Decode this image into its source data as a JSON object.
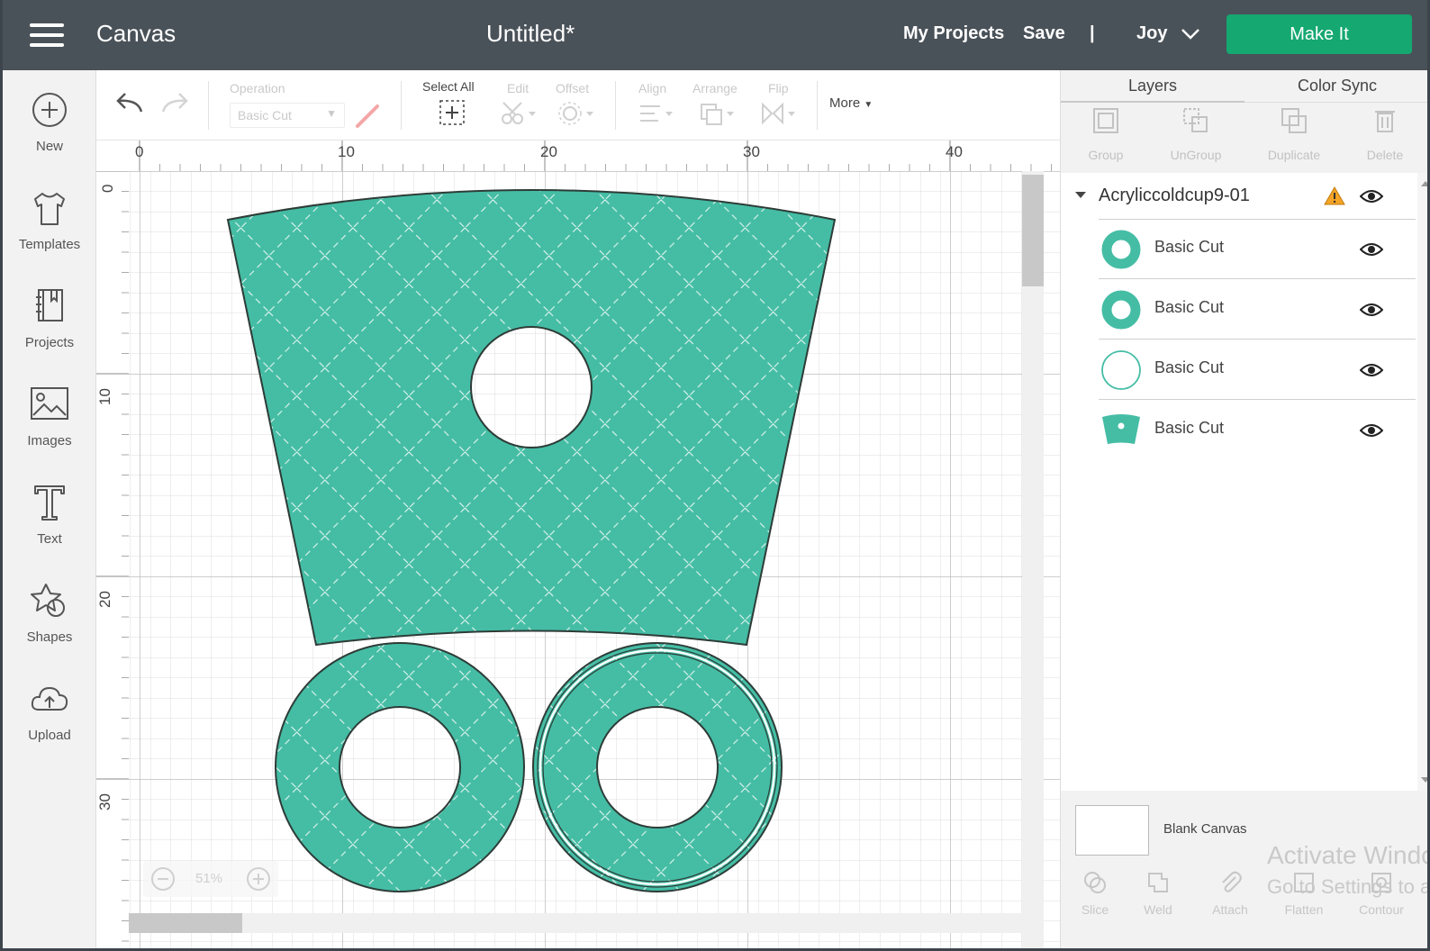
{
  "topbar": {
    "app_title": "Canvas",
    "document_title": "Untitled*",
    "my_projects": "My Projects",
    "save": "Save",
    "separator": "|",
    "user": "Joy",
    "make_it": "Make It"
  },
  "sidebar": {
    "items": [
      {
        "label": "New",
        "icon": "plus-circle-icon"
      },
      {
        "label": "Templates",
        "icon": "tshirt-icon"
      },
      {
        "label": "Projects",
        "icon": "book-icon"
      },
      {
        "label": "Images",
        "icon": "image-icon"
      },
      {
        "label": "Text",
        "icon": "text-t-icon"
      },
      {
        "label": "Shapes",
        "icon": "shapes-icon"
      },
      {
        "label": "Upload",
        "icon": "cloud-upload-icon"
      }
    ]
  },
  "toolbar": {
    "operation_label": "Operation",
    "operation_value": "Basic Cut",
    "select_all": "Select All",
    "edit": "Edit",
    "offset": "Offset",
    "align": "Align",
    "arrange": "Arrange",
    "flip": "Flip",
    "more": "More"
  },
  "rulers": {
    "top": [
      "0",
      "10",
      "20",
      "30",
      "40"
    ],
    "left": [
      "0",
      "10",
      "20",
      "30"
    ]
  },
  "zoom": {
    "label": "51%"
  },
  "colors": {
    "topbar": "#4a5259",
    "accent": "#15a871",
    "shape_fill": "#45bda5",
    "warning": "#f3a325"
  },
  "panel": {
    "tabs": [
      "Layers",
      "Color Sync"
    ],
    "tools": [
      "Group",
      "UnGroup",
      "Duplicate",
      "Delete"
    ],
    "group_name": "Acryliccoldcup9-01",
    "layers": [
      {
        "name": "Basic Cut",
        "thumb": "ring-thick"
      },
      {
        "name": "Basic Cut",
        "thumb": "ring-thick"
      },
      {
        "name": "Basic Cut",
        "thumb": "ring-thin"
      },
      {
        "name": "Basic Cut",
        "thumb": "wrap-shape"
      }
    ],
    "blank_canvas": "Blank Canvas",
    "bottom_tools": [
      "Slice",
      "Weld",
      "Attach",
      "Flatten",
      "Contour"
    ]
  },
  "watermark": {
    "line1": "Activate Windows",
    "line2": "Go to Settings to activate Windows."
  }
}
